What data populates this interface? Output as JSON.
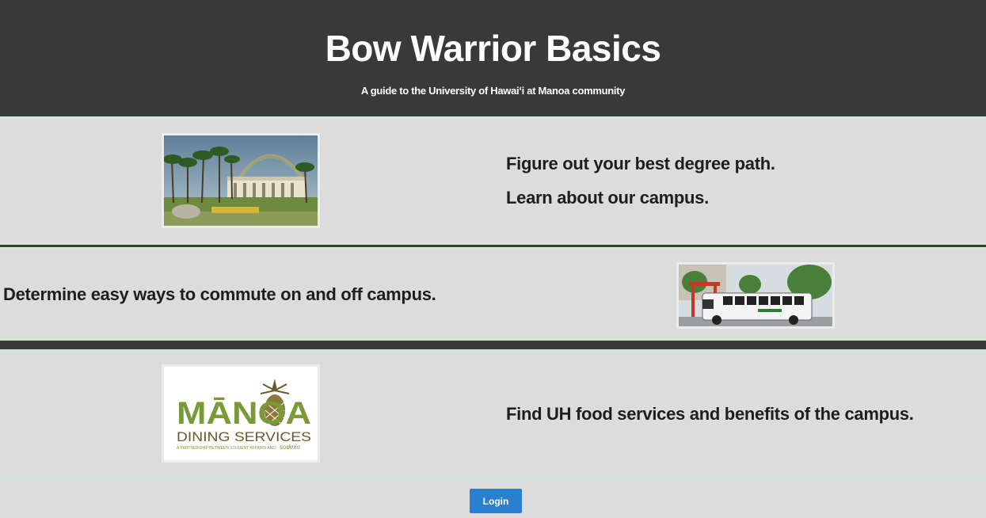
{
  "header": {
    "title": "Bow Warrior Basics",
    "subtitle": "A guide to the University of Hawaiʻi at Manoa community"
  },
  "sections": [
    {
      "lines": [
        "Figure out your best degree path.",
        "Learn about our campus."
      ],
      "image": "campus-photo"
    },
    {
      "lines": [
        "Determine easy ways to commute on and off campus."
      ],
      "image": "shuttle-bus-photo"
    },
    {
      "lines": [
        "Find UH food services and benefits of the campus."
      ],
      "image": "manoa-dining-logo",
      "logo_text": {
        "brand": "MĀNOA",
        "name": "DINING SERVICES",
        "tagline": "A PARTNERSHIP BETWEEN STUDENT AFFAIRS AND",
        "partner": "sodexo"
      }
    }
  ],
  "login": {
    "label": "Login"
  },
  "colors": {
    "header_bg": "#393939",
    "band_bg": "#dcdcdc",
    "button_bg": "#2a7fcf",
    "logo_green": "#7a9a3a",
    "logo_brown": "#6a5a2a"
  }
}
